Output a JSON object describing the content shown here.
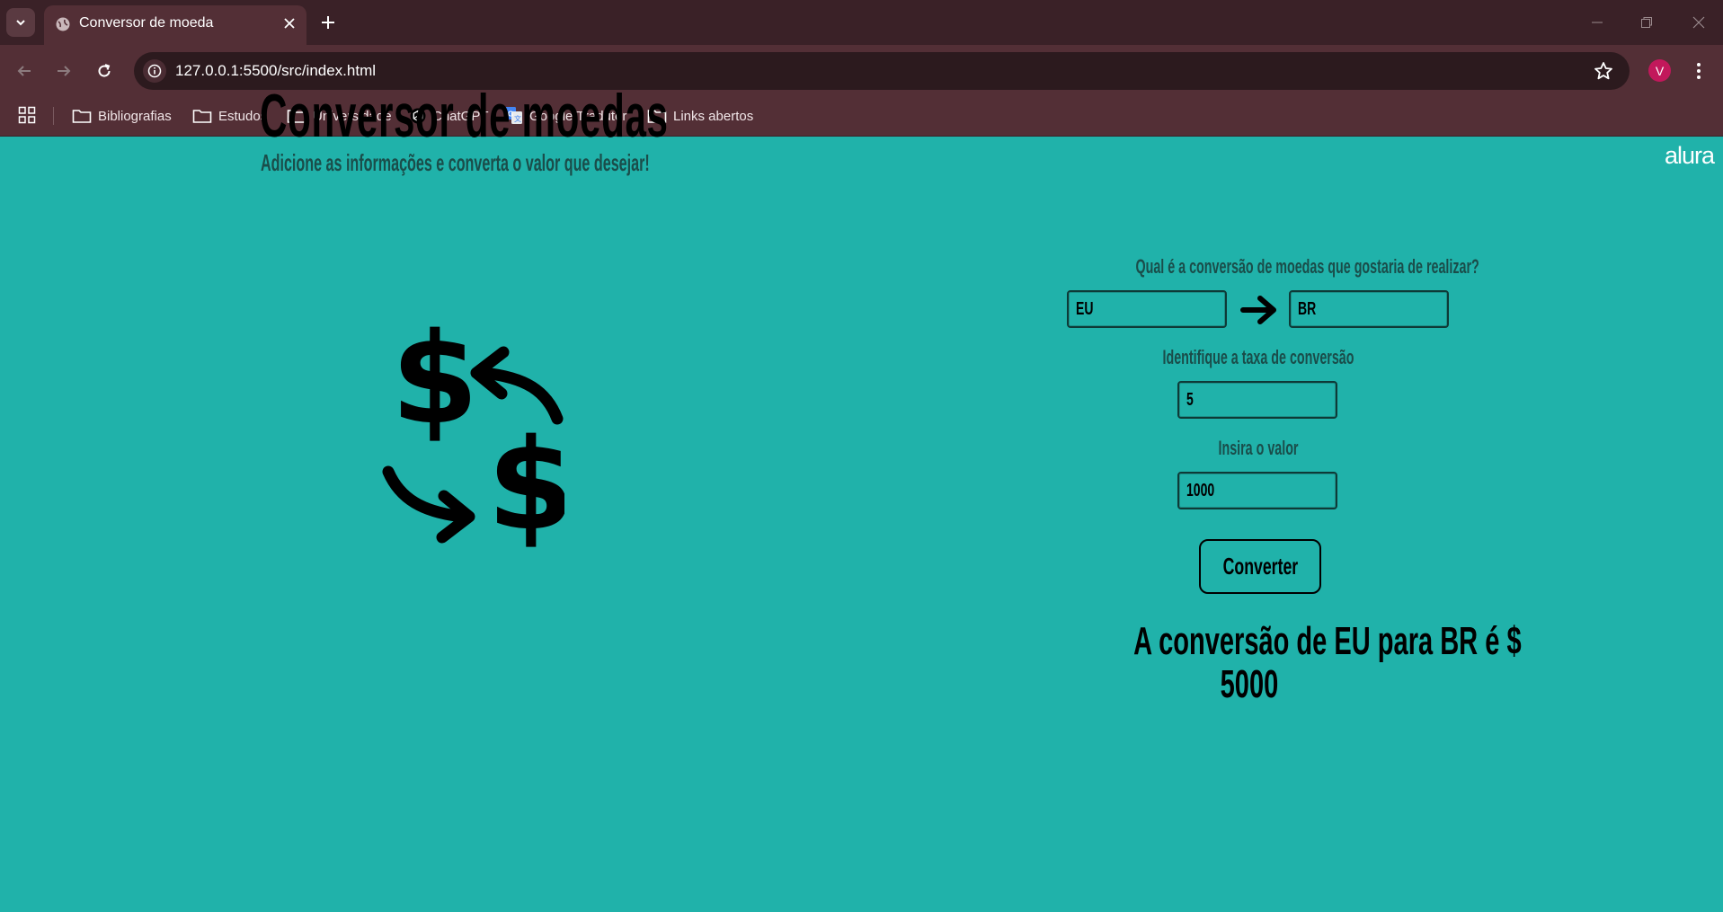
{
  "browser": {
    "tab_title": "Conversor de moeda",
    "url": "127.0.0.1:5500/src/index.html",
    "profile_initial": "V",
    "bookmarks": [
      {
        "label": "Bibliografias",
        "icon": "folder-icon"
      },
      {
        "label": "Estudos",
        "icon": "folder-icon"
      },
      {
        "label": "Universidade",
        "icon": "folder-icon"
      },
      {
        "label": "ChatGPT",
        "icon": "chatgpt-icon"
      },
      {
        "label": "Google Tradutor",
        "icon": "google-translate-icon"
      },
      {
        "label": "Links abertos",
        "icon": "folder-icon"
      }
    ]
  },
  "page": {
    "brand": "alura",
    "title": "Conversor de moedas",
    "subtitle": "Adicione as informações e converta o valor que desejar!",
    "question": "Qual é a conversão de moedas que gostaria de realizar?",
    "from_currency": "EU",
    "to_currency": "BR",
    "rate_label": "Identifique a taxa de conversão",
    "rate_value": "5",
    "amount_label": "Insira o valor",
    "amount_value": "1000",
    "convert_button": "Converter",
    "result_line1": "A conversão de EU para BR é $",
    "result_line2": "5000"
  },
  "colors": {
    "page_background": "#20b2aa",
    "browser_frame": "#3a2127",
    "toolbar": "#532f36",
    "avatar": "#c2185b"
  }
}
